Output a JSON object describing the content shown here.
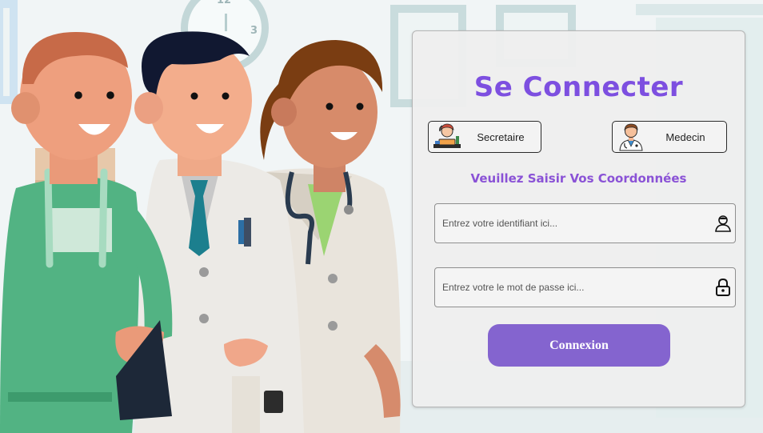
{
  "login": {
    "title": "Se Connecter",
    "roles": [
      {
        "label": "Secretaire",
        "icon": "secretary-icon"
      },
      {
        "label": "Medecin",
        "icon": "doctor-icon"
      }
    ],
    "subtitle": "Veuillez Saisir Vos Coordonnées",
    "username": {
      "placeholder": "Entrez votre identifiant ici...",
      "value": "",
      "icon": "user-icon"
    },
    "password": {
      "placeholder": "Entrez votre le mot de passe ici...",
      "value": "",
      "icon": "lock-icon"
    },
    "submit_label": "Connexion"
  },
  "background": {
    "clock_numbers": [
      "12",
      "3"
    ],
    "illustration": "medical-staff-illustration"
  },
  "colors": {
    "accent_title": "#7d4fe0",
    "accent_subtitle": "#8a52d6",
    "button": "#8464cf"
  }
}
